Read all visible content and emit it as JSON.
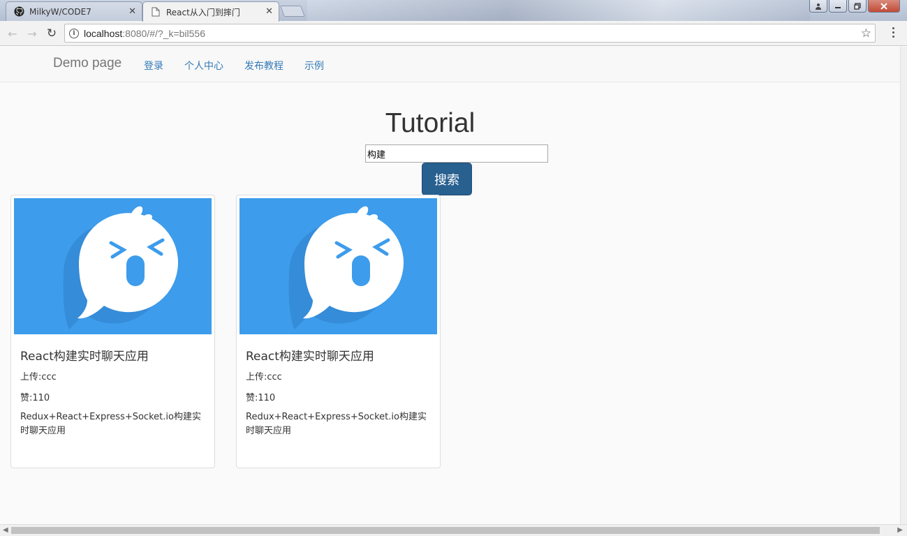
{
  "browser": {
    "tabs": [
      {
        "title": "MilkyW/CODE7",
        "icon": "github-icon",
        "active": false
      },
      {
        "title": "React从入门到摔门",
        "icon": "page-icon",
        "active": true
      }
    ],
    "close_glyph": "✕",
    "url_host": "localhost",
    "url_path": ":8080/#/?_k=bil556",
    "info_glyph": "i",
    "star_glyph": "☆",
    "back_glyph": "←",
    "forward_glyph": "→",
    "reload_glyph": "↻"
  },
  "site": {
    "brand": "Demo page",
    "nav": [
      "登录",
      "个人中心",
      "发布教程",
      "示例"
    ]
  },
  "main": {
    "heading": "Tutorial",
    "search_value": "构建",
    "search_button": "搜索"
  },
  "cards": [
    {
      "title": "React构建实时聊天应用",
      "uploader": "上传:ccc",
      "likes": "赞:110",
      "description": "Redux+React+Express+Socket.io构建实时聊天应用"
    },
    {
      "title": "React构建实时聊天应用",
      "uploader": "上传:ccc",
      "likes": "赞:110",
      "description": "Redux+React+Express+Socket.io构建实时聊天应用"
    }
  ],
  "colors": {
    "thumbnail_bg": "#3d9ceb",
    "link": "#337ab7",
    "primary_button": "#286090"
  }
}
